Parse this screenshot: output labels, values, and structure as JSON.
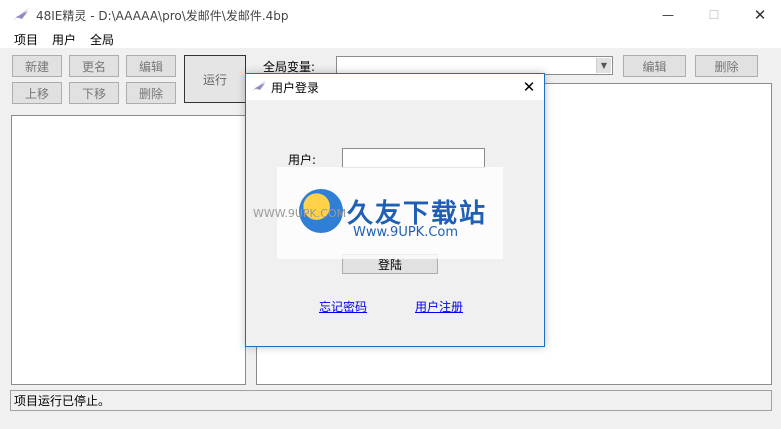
{
  "window": {
    "title": "48IE精灵 - D:\\AAAAA\\pro\\发邮件\\发邮件.4bp",
    "controls": [
      "—",
      "☐",
      "✕"
    ]
  },
  "menu": [
    "项目",
    "用户",
    "全局"
  ],
  "toolbar": {
    "new_label": "新建",
    "rename_label": "更名",
    "edit_label": "编辑",
    "run_label": "运行",
    "moveup_label": "上移",
    "movedown_label": "下移",
    "delete_label": "删除"
  },
  "global_vars": {
    "label": "全局变量:",
    "edit_label": "编辑",
    "delete_label": "删除"
  },
  "status": {
    "text": "项目运行已停止。"
  },
  "login_dialog": {
    "title": "用户登录",
    "user_label": "用户:",
    "user_value": "",
    "login_label": "登陆",
    "forgot_label": "忘记密码",
    "register_label": "用户注册"
  },
  "watermark": {
    "brand": "久友下载站",
    "url": "Www.9UPK.Com",
    "side_url": "WWW.9UPK.COM"
  }
}
